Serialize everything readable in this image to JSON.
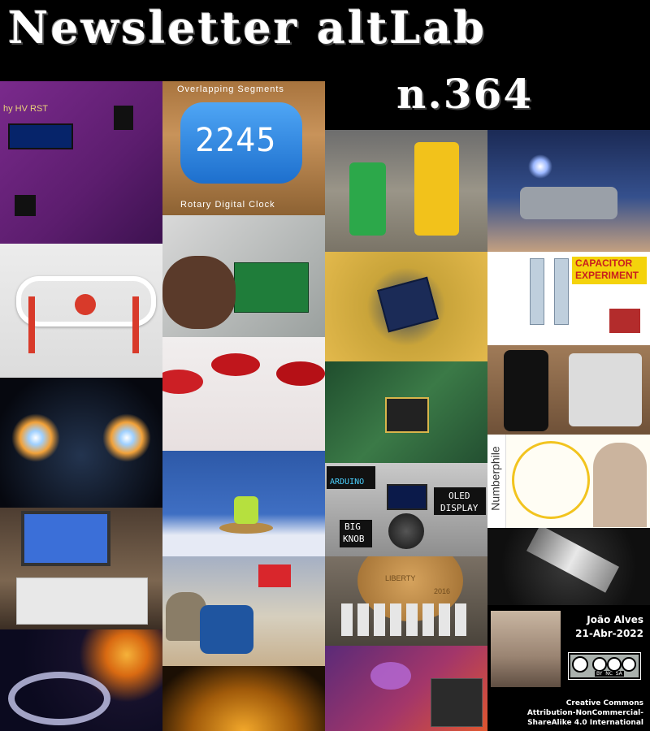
{
  "header": {
    "title": "Newsletter altLab",
    "issue": "n.364"
  },
  "tiles": [
    {
      "name": "hv-rst-pcb",
      "labels": [
        "hy HV RST"
      ]
    },
    {
      "name": "rotary-digital-clock",
      "labels": [
        "Overlapping Segments",
        "2245",
        "Rotary Digital Clock"
      ]
    },
    {
      "name": "cat-robots",
      "labels": []
    },
    {
      "name": "flashlight-device",
      "labels": []
    },
    {
      "name": "gear-mechanism",
      "labels": []
    },
    {
      "name": "hand-pcb",
      "labels": []
    },
    {
      "name": "quantum-chip",
      "labels": []
    },
    {
      "name": "capacitor-experiment",
      "labels": [
        "CAPACITOR",
        "EXPERIMENT"
      ]
    },
    {
      "name": "red-blood-cells",
      "labels": []
    },
    {
      "name": "glowing-atoms",
      "labels": []
    },
    {
      "name": "circuit-board-chip",
      "labels": []
    },
    {
      "name": "phone-controller",
      "labels": []
    },
    {
      "name": "numberphile",
      "labels": [
        "Numberphile"
      ]
    },
    {
      "name": "benchy-coin",
      "labels": []
    },
    {
      "name": "arduino-oled-knob",
      "labels": [
        "ARDUINO",
        "OLED",
        "DISPLAY",
        "BIG",
        "KNOB"
      ]
    },
    {
      "name": "breadboard-display",
      "labels": []
    },
    {
      "name": "quartz-crystal",
      "labels": []
    },
    {
      "name": "space-capsule",
      "labels": []
    },
    {
      "name": "penny-lattice",
      "labels": [
        "LIBERTY",
        "2016"
      ]
    },
    {
      "name": "star-blackhole",
      "labels": []
    },
    {
      "name": "sun-transit",
      "labels": []
    },
    {
      "name": "ubuntu-desktop",
      "labels": []
    }
  ],
  "author": {
    "name": "João Alves",
    "date": "21-Abr-2022"
  },
  "cc_badge": {
    "badge_text": "BY  NC  SA"
  },
  "license": {
    "line1": "Creative Commons",
    "line2": "Attribution-NonCommercial-",
    "line3": "ShareAlike 4.0 International"
  },
  "colors": {
    "background": "#000000",
    "text": "#ffffff"
  }
}
